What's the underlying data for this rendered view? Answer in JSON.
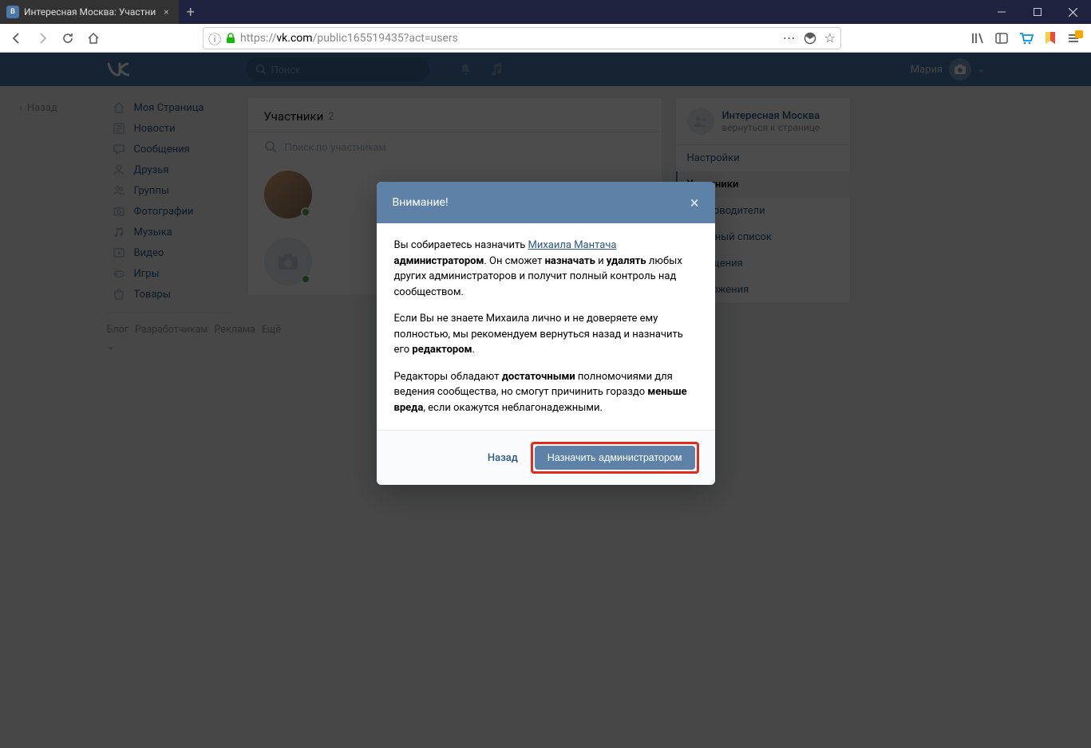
{
  "browser": {
    "tab_title": "Интересная Москва: Участни",
    "url_prefix": "https://",
    "url_host": "vk.com",
    "url_path": "/public165519435?act=users"
  },
  "vk": {
    "search_placeholder": "Поиск",
    "username": "Мария"
  },
  "back_label": "Назад",
  "nav": {
    "items": [
      {
        "icon": "home",
        "label": "Моя Страница"
      },
      {
        "icon": "news",
        "label": "Новости"
      },
      {
        "icon": "msg",
        "label": "Сообщения"
      },
      {
        "icon": "friends",
        "label": "Друзья"
      },
      {
        "icon": "groups",
        "label": "Группы"
      },
      {
        "icon": "photos",
        "label": "Фотографии"
      },
      {
        "icon": "music",
        "label": "Музыка"
      },
      {
        "icon": "video",
        "label": "Видео"
      },
      {
        "icon": "games",
        "label": "Игры"
      },
      {
        "icon": "market",
        "label": "Товары"
      }
    ],
    "footer": [
      "Блог",
      "Разработчикам",
      "Реклама",
      "Ещё ⌄"
    ]
  },
  "members": {
    "title": "Участники",
    "count": "2",
    "search_placeholder": "Поиск по участникам"
  },
  "sidebar": {
    "group_title": "Интересная Москва",
    "group_subtitle": "вернуться к странице",
    "items": [
      {
        "label": "Настройки",
        "active": false,
        "sub": false
      },
      {
        "label": "Участники",
        "active": true,
        "sub": false
      },
      {
        "label": "Руководители",
        "active": false,
        "sub": true
      },
      {
        "label": "Чёрный список",
        "active": false,
        "sub": true
      },
      {
        "label": "Сообщения",
        "active": false,
        "sub": false
      },
      {
        "label": "Приложения",
        "active": false,
        "sub": false
      }
    ]
  },
  "modal": {
    "title": "Внимание!",
    "p1_a": "Вы собираетесь назначить ",
    "p1_link": "Михаила Мантача",
    "p1_b": " ",
    "p1_bold1": "администратором",
    "p1_c": ". Он сможет ",
    "p1_bold2": "назначать",
    "p1_d": " и ",
    "p1_bold3": "удалять",
    "p1_e": " любых других администраторов и получит полный контроль над сообществом.",
    "p2_a": "Если Вы не знаете Михаила лично и не доверяете ему полностью, мы рекомендуем вернуться назад и назначить его ",
    "p2_bold": "редактором",
    "p2_b": ".",
    "p3_a": "Редакторы обладают ",
    "p3_bold1": "достаточными",
    "p3_b": " полномочиями для ведения сообщества, но смогут причинить гораздо ",
    "p3_bold2": "меньше вреда",
    "p3_c": ", если окажутся неблагонадежными.",
    "back_label": "Назад",
    "confirm_label": "Назначить администратором"
  }
}
